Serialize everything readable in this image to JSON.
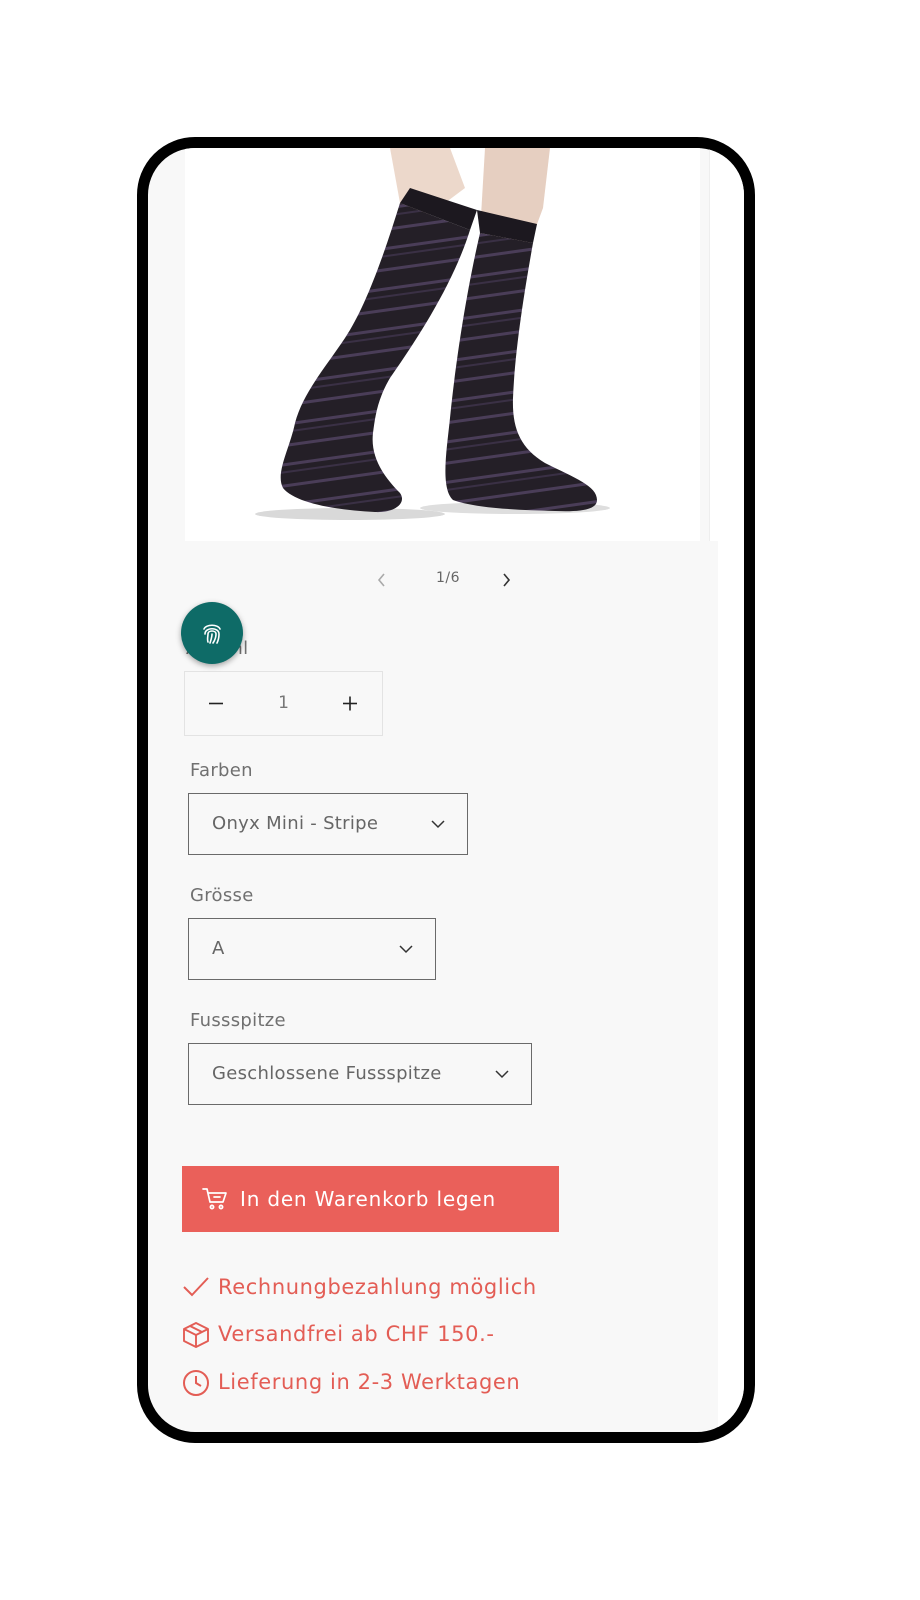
{
  "slider": {
    "counter": "1/6"
  },
  "quantity": {
    "label": "Anzahl",
    "value": "1",
    "minus": "−",
    "plus": "+"
  },
  "options": {
    "color": {
      "label": "Farben",
      "value": "Onyx Mini - Stripe"
    },
    "size": {
      "label": "Grösse",
      "value": "A"
    },
    "toe": {
      "label": "Fussspitze",
      "value": "Geschlossene Fussspitze"
    }
  },
  "cart": {
    "label": "In den Warenkorb legen"
  },
  "features": [
    {
      "icon": "check-icon",
      "text": "Rechnungbezahlung möglich"
    },
    {
      "icon": "box-icon",
      "text": "Versandfrei ab CHF 150.-"
    },
    {
      "icon": "clock-icon",
      "text": "Lieferung in 2-3 Werktagen"
    }
  ],
  "colors": {
    "accent": "#ea605a",
    "accent_text": "#e35d55",
    "fab": "#0e6b67"
  }
}
